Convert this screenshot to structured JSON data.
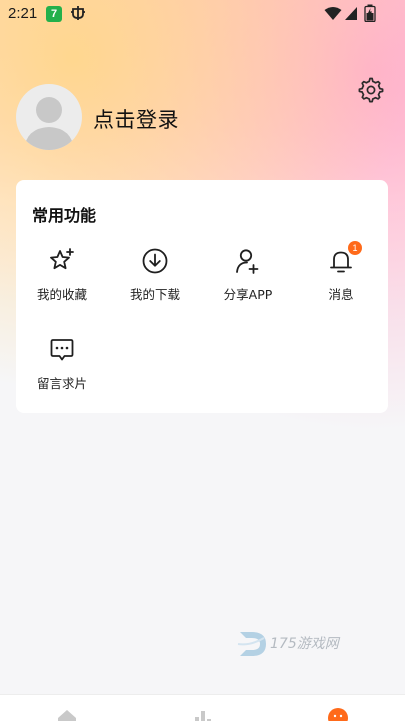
{
  "status_bar": {
    "time": "2:21",
    "app_icon_text": "7",
    "icons": [
      "bug-icon",
      "wifi-icon",
      "signal-icon",
      "battery-icon"
    ]
  },
  "header": {
    "login_text": "点击登录",
    "settings_icon": "gear-icon"
  },
  "common_functions": {
    "title": "常用功能",
    "items": [
      {
        "label": "我的收藏",
        "icon": "star-sparkle-icon"
      },
      {
        "label": "我的下载",
        "icon": "download-icon"
      },
      {
        "label": "分享APP",
        "icon": "user-add-icon"
      },
      {
        "label": "消息",
        "icon": "bell-icon",
        "badge": "1"
      },
      {
        "label": "留言求片",
        "icon": "chat-bubble-icon"
      }
    ]
  },
  "watermark": {
    "text": "175游戏网"
  },
  "bottom_nav": {
    "items": [
      "home-icon",
      "ranking-icon",
      "profile-icon"
    ]
  },
  "colors": {
    "badge": "#ff6a1a",
    "accent_profile": "#ff6a1a",
    "card_bg": "#ffffff",
    "page_bg": "#f6f6f8"
  }
}
